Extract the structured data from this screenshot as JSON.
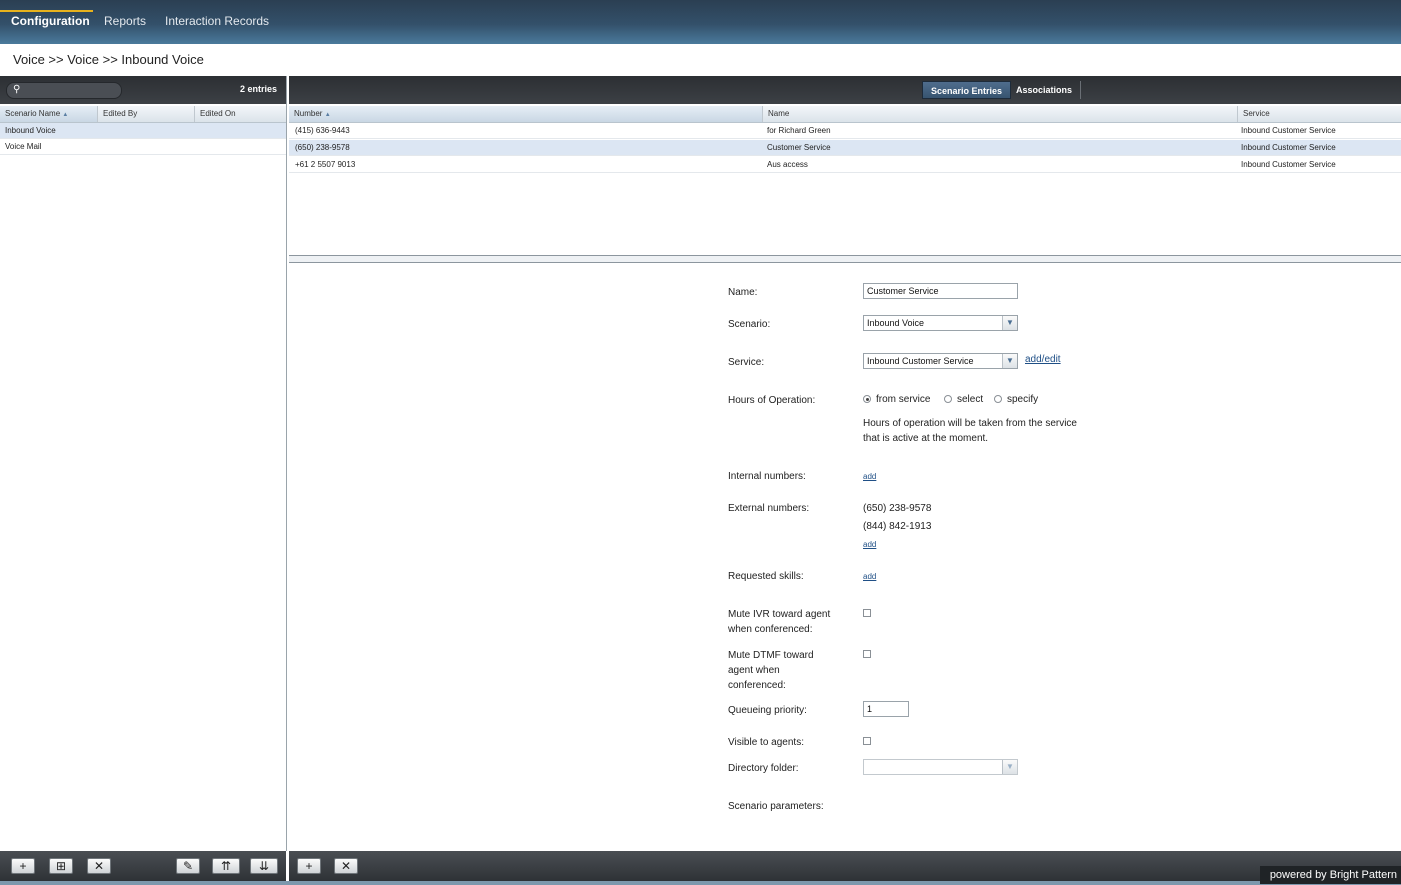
{
  "topnav": {
    "tabs": [
      {
        "label": "Configuration"
      },
      {
        "label": "Reports"
      },
      {
        "label": "Interaction Records"
      }
    ]
  },
  "breadcrumb": "Voice >> Voice >> Inbound Voice",
  "left": {
    "entries_count": "2 entries",
    "columns": [
      "Scenario Name",
      "Edited By",
      "Edited On"
    ],
    "sort_indicator": "▲",
    "rows": [
      {
        "name": "Inbound Voice",
        "edited_by": "",
        "edited_on": ""
      },
      {
        "name": "Voice Mail",
        "edited_by": "",
        "edited_on": ""
      }
    ],
    "toolbar": [
      "+",
      "⊞",
      "✕",
      "✎",
      "⇈",
      "⇊"
    ]
  },
  "right": {
    "tabs": [
      {
        "label": "Scenario Entries"
      },
      {
        "label": "Associations"
      }
    ],
    "columns": [
      "Number",
      "Name",
      "Service"
    ],
    "sort_indicator": "▲",
    "rows": [
      {
        "number": "(415) 636-9443",
        "name": "for Richard Green",
        "service": "Inbound Customer Service"
      },
      {
        "number": "(650) 238-9578",
        "name": "Customer Service",
        "service": "Inbound Customer Service"
      },
      {
        "number": "+61 2 5507 9013",
        "name": "Aus access",
        "service": "Inbound Customer Service"
      }
    ],
    "toolbar": [
      "+",
      "✕"
    ]
  },
  "form": {
    "name_label": "Name:",
    "name_value": "Customer Service",
    "scenario_label": "Scenario:",
    "scenario_value": "Inbound Voice",
    "service_label": "Service:",
    "service_value": "Inbound Customer Service",
    "service_link": "add/edit",
    "hours_label": "Hours of Operation:",
    "hours_options": [
      "from service",
      "select",
      "specify"
    ],
    "hours_note_1": "Hours of operation will be taken from the service",
    "hours_note_2": "that is active at the moment.",
    "internal_label": "Internal numbers:",
    "internal_link": "add",
    "external_label": "External numbers:",
    "external_numbers": [
      "(650) 238-9578",
      "(844) 842-1913"
    ],
    "external_link": "add",
    "skills_label": "Requested skills:",
    "skills_link": "add",
    "mute_ivr_label_1": "Mute IVR toward agent",
    "mute_ivr_label_2": "when conferenced:",
    "mute_dtmf_label_1": "Mute DTMF toward",
    "mute_dtmf_label_2": "agent when",
    "mute_dtmf_label_3": "conferenced:",
    "priority_label": "Queueing priority:",
    "priority_value": "1",
    "visible_label": "Visible to agents:",
    "folder_label": "Directory folder:",
    "folder_value": "",
    "params_label": "Scenario parameters:"
  },
  "footer": {
    "powered": "powered by Bright Pattern"
  },
  "colors": {
    "active_tab_accent": "#e8b21c",
    "selected_row": "#dce6f3",
    "link": "#1f4f86"
  }
}
